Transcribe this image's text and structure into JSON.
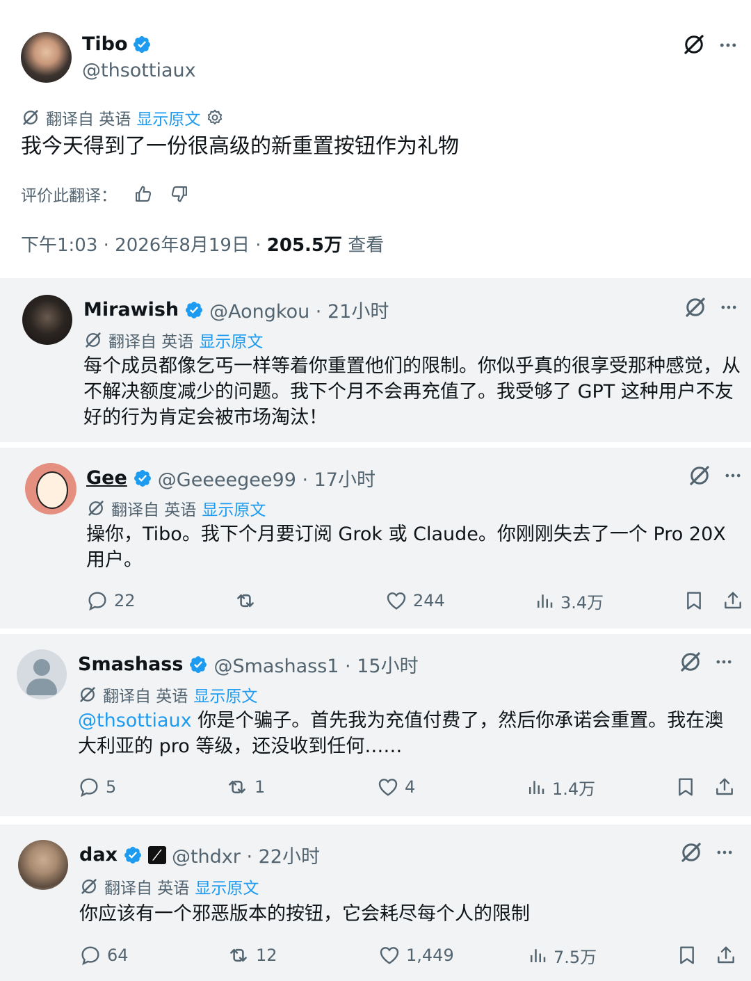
{
  "main_tweet": {
    "name": "Tibo",
    "handle": "@thsottiaux",
    "translated_from": "翻译自 英语",
    "show_original": "显示原文",
    "text": "我今天得到了一份很高级的新重置按钮作为礼物",
    "rate_label": "评价此翻译：",
    "time": "下午1:03 · 2026年8月19日 · ",
    "views": "205.5万",
    "views_label": "查看"
  },
  "replies": [
    {
      "name": "Mirawish",
      "handle": "@Aongkou · 21小时",
      "translated_from": "翻译自 英语",
      "show_original": "显示原文",
      "text": "每个成员都像乞丐一样等着你重置他们的限制。你似乎真的很享受那种感觉，从不解决额度减少的问题。我下个月不会再充值了。我受够了 GPT 这种用户不友好的行为肯定会被市场淘汰！"
    },
    {
      "name": "Gee",
      "handle": "@Geeeegee99 · 17小时",
      "translated_from": "翻译自 英语",
      "show_original": "显示原文",
      "text": "操你，Tibo。我下个月要订阅 Grok 或 Claude。你刚刚失去了一个 Pro 20X 用户。",
      "replies": "22",
      "reposts": "",
      "likes": "244",
      "views": "3.4万"
    },
    {
      "name": "Smashass",
      "handle": "@Smashass1 · 15小时",
      "translated_from": "翻译自 英语",
      "show_original": "显示原文",
      "mention": "@thsottiaux",
      "text": " 你是个骗子。首先我为充值付费了，然后你承诺会重置。我在澳大利亚的 pro 等级，还没收到任何……",
      "replies": "5",
      "reposts": "1",
      "likes": "4",
      "views": "1.4万"
    },
    {
      "name": "dax",
      "handle": "@thdxr · 22小时",
      "translated_from": "翻译自 英语",
      "show_original": "显示原文",
      "text": "你应该有一个邪恶版本的按钮，它会耗尽每个人的限制",
      "replies": "64",
      "reposts": "12",
      "likes": "1,449",
      "views": "7.5万"
    }
  ],
  "colors": {
    "accent": "#1d9bf0",
    "text": "#0f1419",
    "muted": "#536471",
    "reply_bg": "#f2f3f4"
  }
}
